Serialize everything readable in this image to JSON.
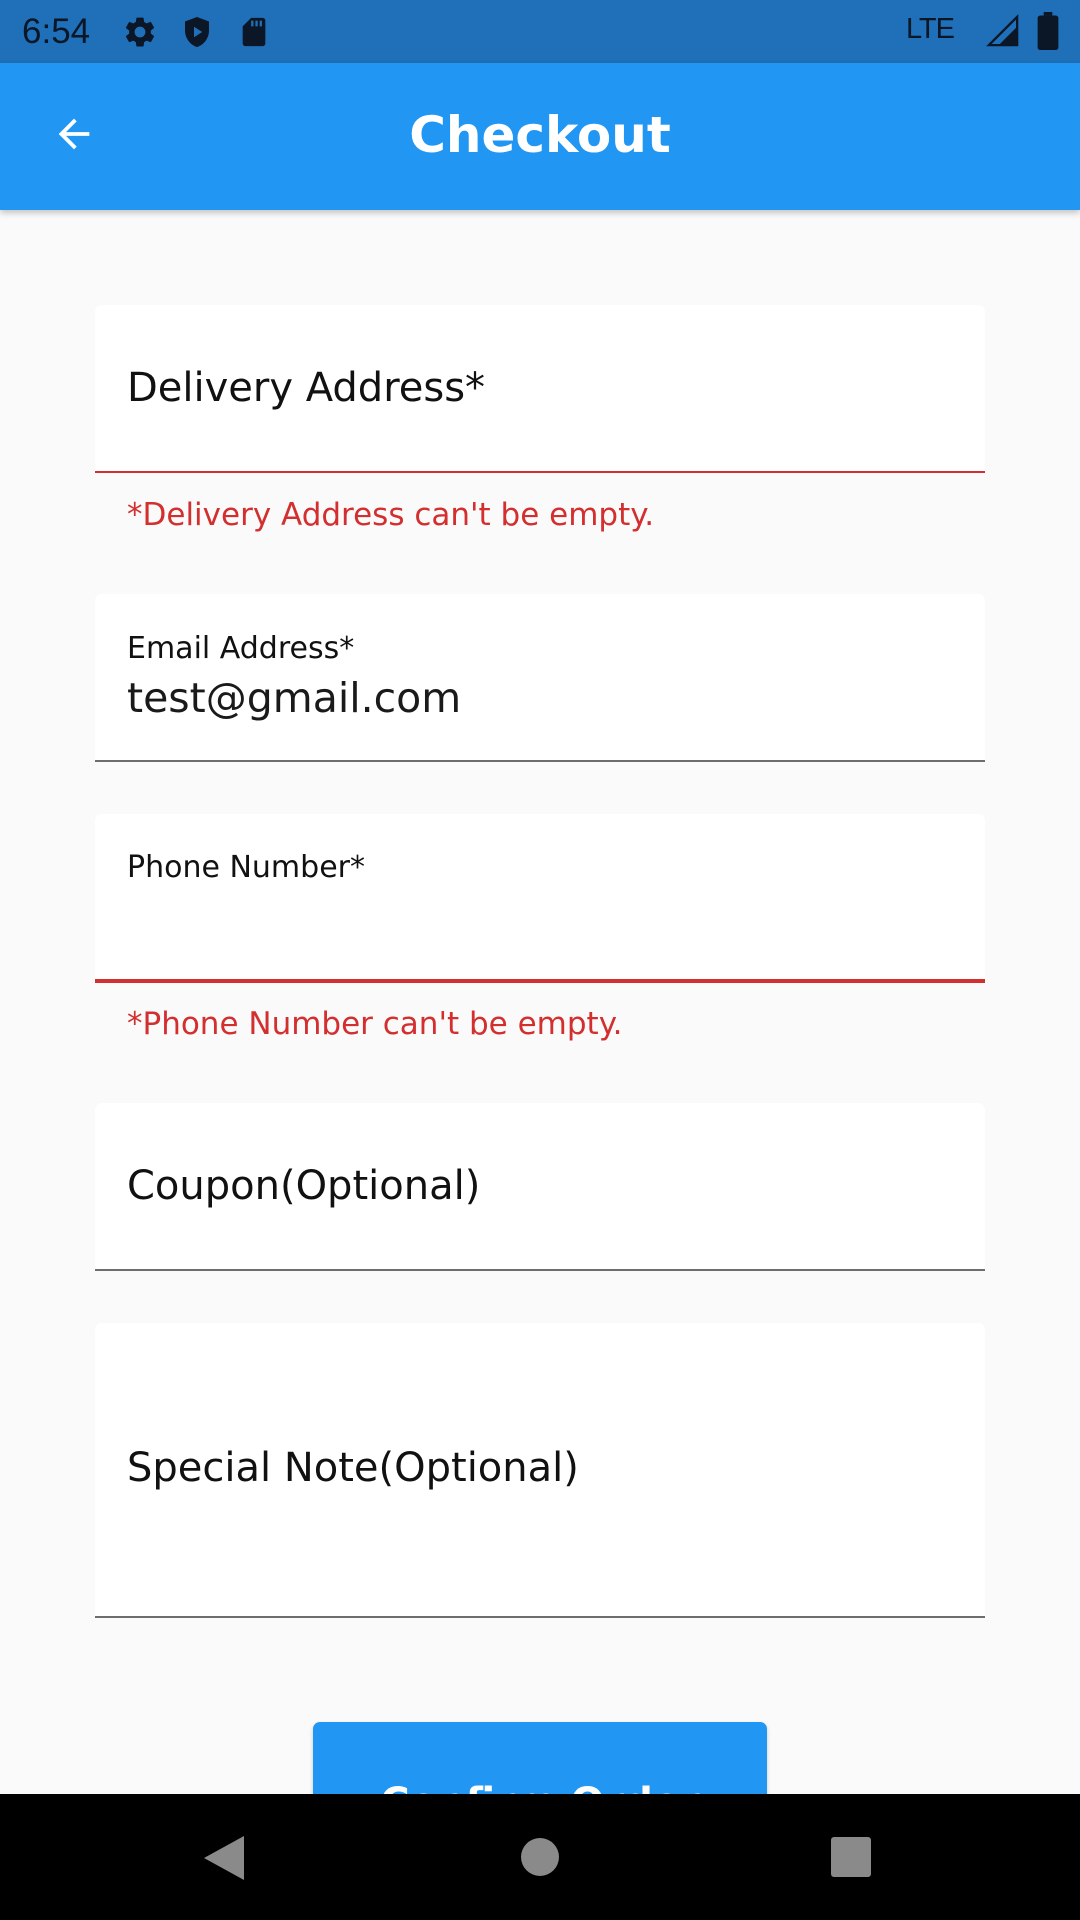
{
  "status_bar": {
    "time": "6:54",
    "network": "LTE",
    "icons": [
      "settings-icon",
      "shield-play-icon",
      "sd-card-icon",
      "signal-icon",
      "battery-icon"
    ]
  },
  "app_bar": {
    "title": "Checkout",
    "back_icon": "arrow-back-icon"
  },
  "form": {
    "delivery_address": {
      "label": "Delivery Address*",
      "value": "",
      "error": "*Delivery Address can't be empty."
    },
    "email": {
      "label": "Email Address*",
      "value": "test@gmail.com"
    },
    "phone": {
      "label": "Phone Number*",
      "value": "",
      "error": "*Phone Number can't be empty."
    },
    "coupon": {
      "label": "Coupon(Optional)",
      "value": ""
    },
    "special_note": {
      "label": "Special Note(Optional)",
      "value": ""
    }
  },
  "confirm_button": {
    "label": "Confirm Order"
  },
  "nav_bar": {
    "icons": [
      "back-triangle-icon",
      "home-circle-icon",
      "recents-square-icon"
    ]
  },
  "colors": {
    "status_bar": "#1f70b8",
    "app_bar": "#2196f3",
    "error": "#d32f2f",
    "background": "#fafafa"
  }
}
